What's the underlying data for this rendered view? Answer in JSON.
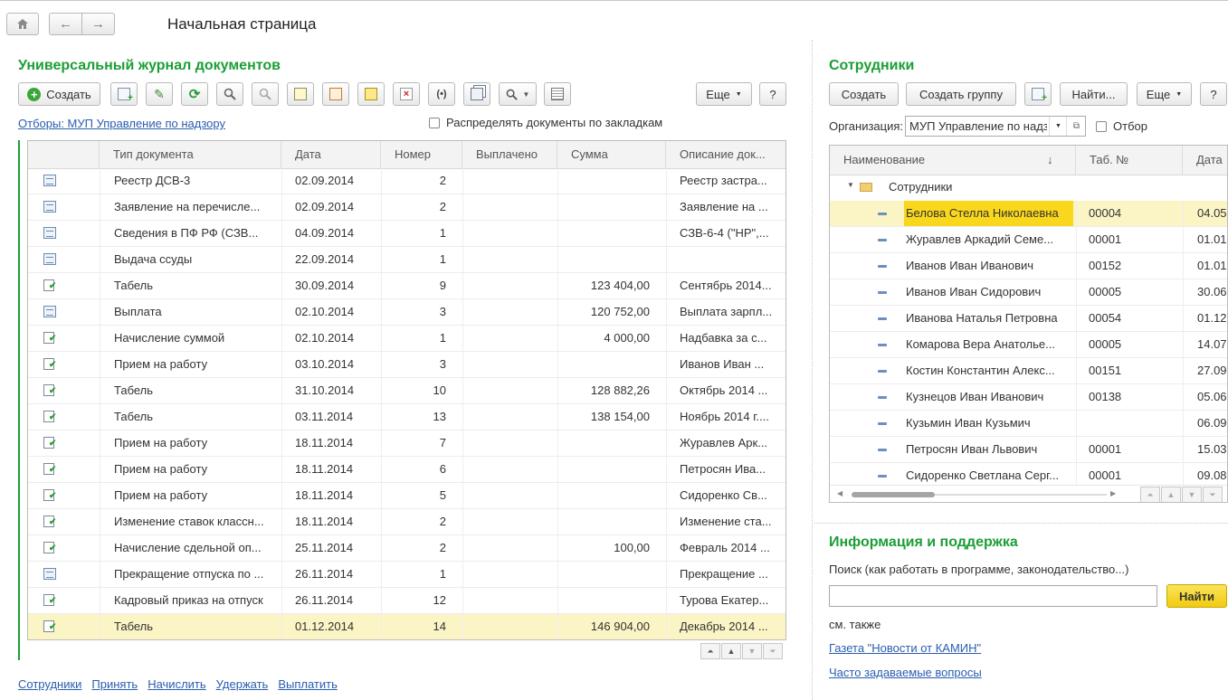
{
  "page_title": "Начальная страница",
  "journal": {
    "title": "Универсальный журнал документов",
    "create_label": "Создать",
    "more_label": "Еще",
    "help_label": "?",
    "filter_link": "Отборы: МУП Управление по надзору",
    "distribute_label": "Распределять документы по закладкам",
    "columns": [
      "Тип документа",
      "Дата",
      "Номер",
      "Выплачено",
      "Сумма",
      "Описание док..."
    ],
    "rows": [
      {
        "icon": "doc",
        "type": "Реестр ДСВ-3",
        "date": "02.09.2014",
        "num": "2",
        "paid": "",
        "sum": "",
        "desc": "Реестр застра..."
      },
      {
        "icon": "doc",
        "type": "Заявление на перечисле...",
        "date": "02.09.2014",
        "num": "2",
        "paid": "",
        "sum": "",
        "desc": "Заявление на ..."
      },
      {
        "icon": "doc",
        "type": "Сведения в ПФ РФ (СЗВ...",
        "date": "04.09.2014",
        "num": "1",
        "paid": "",
        "sum": "",
        "desc": "СЗВ-6-4 (\"НР\",..."
      },
      {
        "icon": "doc",
        "type": "Выдача ссуды",
        "date": "22.09.2014",
        "num": "1",
        "paid": "",
        "sum": "",
        "desc": ""
      },
      {
        "icon": "posted",
        "type": "Табель",
        "date": "30.09.2014",
        "num": "9",
        "paid": "",
        "sum": "123 404,00",
        "desc": "Сентябрь 2014..."
      },
      {
        "icon": "doc",
        "type": "Выплата",
        "date": "02.10.2014",
        "num": "3",
        "paid": "",
        "sum": "120 752,00",
        "desc": "Выплата зарпл..."
      },
      {
        "icon": "posted",
        "type": "Начисление суммой",
        "date": "02.10.2014",
        "num": "1",
        "paid": "",
        "sum": "4 000,00",
        "desc": "Надбавка за с..."
      },
      {
        "icon": "posted",
        "type": "Прием на работу",
        "date": "03.10.2014",
        "num": "3",
        "paid": "",
        "sum": "",
        "desc": "Иванов Иван ..."
      },
      {
        "icon": "posted",
        "type": "Табель",
        "date": "31.10.2014",
        "num": "10",
        "paid": "",
        "sum": "128 882,26",
        "desc": "Октябрь 2014 ..."
      },
      {
        "icon": "posted",
        "type": "Табель",
        "date": "03.11.2014",
        "num": "13",
        "paid": "",
        "sum": "138 154,00",
        "desc": "Ноябрь 2014 г...."
      },
      {
        "icon": "posted",
        "type": "Прием на работу",
        "date": "18.11.2014",
        "num": "7",
        "paid": "",
        "sum": "",
        "desc": "Журавлев Арк..."
      },
      {
        "icon": "posted",
        "type": "Прием на работу",
        "date": "18.11.2014",
        "num": "6",
        "paid": "",
        "sum": "",
        "desc": "Петросян Ива..."
      },
      {
        "icon": "posted",
        "type": "Прием на работу",
        "date": "18.11.2014",
        "num": "5",
        "paid": "",
        "sum": "",
        "desc": "Сидоренко Св..."
      },
      {
        "icon": "posted",
        "type": "Изменение ставок классн...",
        "date": "18.11.2014",
        "num": "2",
        "paid": "",
        "sum": "",
        "desc": "Изменение ста..."
      },
      {
        "icon": "posted",
        "type": "Начисление сдельной оп...",
        "date": "25.11.2014",
        "num": "2",
        "paid": "",
        "sum": "100,00",
        "desc": "Февраль 2014 ..."
      },
      {
        "icon": "doc",
        "type": "Прекращение отпуска по ...",
        "date": "26.11.2014",
        "num": "1",
        "paid": "",
        "sum": "",
        "desc": "Прекращение ..."
      },
      {
        "icon": "posted",
        "type": "Кадровый приказ на отпуск",
        "date": "26.11.2014",
        "num": "12",
        "paid": "",
        "sum": "",
        "desc": "Турова Екатер..."
      },
      {
        "icon": "posted",
        "type": "Табель",
        "date": "01.12.2014",
        "num": "14",
        "paid": "",
        "sum": "146 904,00",
        "desc": "Декабрь 2014 ...",
        "selected": true
      }
    ],
    "bottom_links": [
      "Сотрудники",
      "Принять",
      "Начислить",
      "Удержать",
      "Выплатить"
    ]
  },
  "employees": {
    "title": "Сотрудники",
    "create_label": "Создать",
    "create_group_label": "Создать группу",
    "find_label": "Найти...",
    "more_label": "Еще",
    "help_label": "?",
    "org_label": "Организация:",
    "org_value": "МУП Управление по надз",
    "filter_label": "Отбор",
    "columns": [
      "Наименование",
      "Таб. №",
      "Дата"
    ],
    "sort_arrow": "↓",
    "group_label": "Сотрудники",
    "rows": [
      {
        "name": "Белова Стелла Николаевна",
        "tab": "00004",
        "date": "04.05",
        "selected": true
      },
      {
        "name": "Журавлев Аркадий Семе...",
        "tab": "00001",
        "date": "01.01"
      },
      {
        "name": "Иванов Иван Иванович",
        "tab": "00152",
        "date": "01.01"
      },
      {
        "name": "Иванов Иван Сидорович",
        "tab": "00005",
        "date": "30.06"
      },
      {
        "name": "Иванова Наталья Петровна",
        "tab": "00054",
        "date": "01.12"
      },
      {
        "name": "Комарова Вера Анатолье...",
        "tab": "00005",
        "date": "14.07"
      },
      {
        "name": "Костин Константин Алекс...",
        "tab": "00151",
        "date": "27.09"
      },
      {
        "name": "Кузнецов Иван Иванович",
        "tab": "00138",
        "date": "05.06"
      },
      {
        "name": "Кузьмин Иван Кузьмич",
        "tab": "",
        "date": "06.09"
      },
      {
        "name": "Петросян Иван Львович",
        "tab": "00001",
        "date": "15.03"
      },
      {
        "name": "Сидоренко Светлана Серг...",
        "tab": "00001",
        "date": "09.08"
      }
    ]
  },
  "support": {
    "title": "Информация и поддержка",
    "search_label": "Поиск (как работать в программе, законодательство...)",
    "search_value": "",
    "find_label": "Найти",
    "see_also": "см. также",
    "links": [
      "Газета \"Новости от КАМИН\"",
      "Часто задаваемые вопросы"
    ]
  },
  "colors": {
    "accent_green": "#1b9e36",
    "selection": "#fbf4c4",
    "highlight": "#f9d71c",
    "link": "#2a5db0"
  }
}
